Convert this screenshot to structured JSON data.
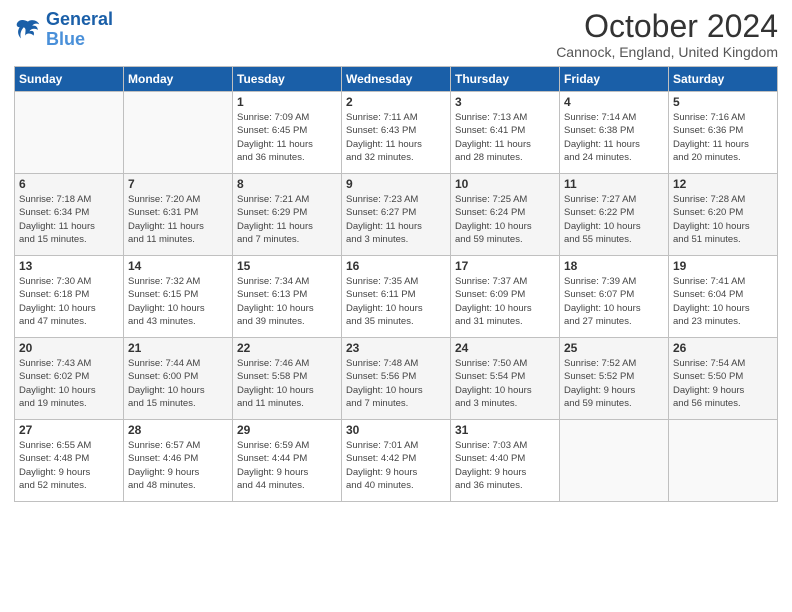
{
  "header": {
    "logo_line1": "General",
    "logo_line2": "Blue",
    "month": "October 2024",
    "location": "Cannock, England, United Kingdom"
  },
  "days_of_week": [
    "Sunday",
    "Monday",
    "Tuesday",
    "Wednesday",
    "Thursday",
    "Friday",
    "Saturday"
  ],
  "weeks": [
    [
      {
        "day": "",
        "info": ""
      },
      {
        "day": "",
        "info": ""
      },
      {
        "day": "1",
        "info": "Sunrise: 7:09 AM\nSunset: 6:45 PM\nDaylight: 11 hours\nand 36 minutes."
      },
      {
        "day": "2",
        "info": "Sunrise: 7:11 AM\nSunset: 6:43 PM\nDaylight: 11 hours\nand 32 minutes."
      },
      {
        "day": "3",
        "info": "Sunrise: 7:13 AM\nSunset: 6:41 PM\nDaylight: 11 hours\nand 28 minutes."
      },
      {
        "day": "4",
        "info": "Sunrise: 7:14 AM\nSunset: 6:38 PM\nDaylight: 11 hours\nand 24 minutes."
      },
      {
        "day": "5",
        "info": "Sunrise: 7:16 AM\nSunset: 6:36 PM\nDaylight: 11 hours\nand 20 minutes."
      }
    ],
    [
      {
        "day": "6",
        "info": "Sunrise: 7:18 AM\nSunset: 6:34 PM\nDaylight: 11 hours\nand 15 minutes."
      },
      {
        "day": "7",
        "info": "Sunrise: 7:20 AM\nSunset: 6:31 PM\nDaylight: 11 hours\nand 11 minutes."
      },
      {
        "day": "8",
        "info": "Sunrise: 7:21 AM\nSunset: 6:29 PM\nDaylight: 11 hours\nand 7 minutes."
      },
      {
        "day": "9",
        "info": "Sunrise: 7:23 AM\nSunset: 6:27 PM\nDaylight: 11 hours\nand 3 minutes."
      },
      {
        "day": "10",
        "info": "Sunrise: 7:25 AM\nSunset: 6:24 PM\nDaylight: 10 hours\nand 59 minutes."
      },
      {
        "day": "11",
        "info": "Sunrise: 7:27 AM\nSunset: 6:22 PM\nDaylight: 10 hours\nand 55 minutes."
      },
      {
        "day": "12",
        "info": "Sunrise: 7:28 AM\nSunset: 6:20 PM\nDaylight: 10 hours\nand 51 minutes."
      }
    ],
    [
      {
        "day": "13",
        "info": "Sunrise: 7:30 AM\nSunset: 6:18 PM\nDaylight: 10 hours\nand 47 minutes."
      },
      {
        "day": "14",
        "info": "Sunrise: 7:32 AM\nSunset: 6:15 PM\nDaylight: 10 hours\nand 43 minutes."
      },
      {
        "day": "15",
        "info": "Sunrise: 7:34 AM\nSunset: 6:13 PM\nDaylight: 10 hours\nand 39 minutes."
      },
      {
        "day": "16",
        "info": "Sunrise: 7:35 AM\nSunset: 6:11 PM\nDaylight: 10 hours\nand 35 minutes."
      },
      {
        "day": "17",
        "info": "Sunrise: 7:37 AM\nSunset: 6:09 PM\nDaylight: 10 hours\nand 31 minutes."
      },
      {
        "day": "18",
        "info": "Sunrise: 7:39 AM\nSunset: 6:07 PM\nDaylight: 10 hours\nand 27 minutes."
      },
      {
        "day": "19",
        "info": "Sunrise: 7:41 AM\nSunset: 6:04 PM\nDaylight: 10 hours\nand 23 minutes."
      }
    ],
    [
      {
        "day": "20",
        "info": "Sunrise: 7:43 AM\nSunset: 6:02 PM\nDaylight: 10 hours\nand 19 minutes."
      },
      {
        "day": "21",
        "info": "Sunrise: 7:44 AM\nSunset: 6:00 PM\nDaylight: 10 hours\nand 15 minutes."
      },
      {
        "day": "22",
        "info": "Sunrise: 7:46 AM\nSunset: 5:58 PM\nDaylight: 10 hours\nand 11 minutes."
      },
      {
        "day": "23",
        "info": "Sunrise: 7:48 AM\nSunset: 5:56 PM\nDaylight: 10 hours\nand 7 minutes."
      },
      {
        "day": "24",
        "info": "Sunrise: 7:50 AM\nSunset: 5:54 PM\nDaylight: 10 hours\nand 3 minutes."
      },
      {
        "day": "25",
        "info": "Sunrise: 7:52 AM\nSunset: 5:52 PM\nDaylight: 9 hours\nand 59 minutes."
      },
      {
        "day": "26",
        "info": "Sunrise: 7:54 AM\nSunset: 5:50 PM\nDaylight: 9 hours\nand 56 minutes."
      }
    ],
    [
      {
        "day": "27",
        "info": "Sunrise: 6:55 AM\nSunset: 4:48 PM\nDaylight: 9 hours\nand 52 minutes."
      },
      {
        "day": "28",
        "info": "Sunrise: 6:57 AM\nSunset: 4:46 PM\nDaylight: 9 hours\nand 48 minutes."
      },
      {
        "day": "29",
        "info": "Sunrise: 6:59 AM\nSunset: 4:44 PM\nDaylight: 9 hours\nand 44 minutes."
      },
      {
        "day": "30",
        "info": "Sunrise: 7:01 AM\nSunset: 4:42 PM\nDaylight: 9 hours\nand 40 minutes."
      },
      {
        "day": "31",
        "info": "Sunrise: 7:03 AM\nSunset: 4:40 PM\nDaylight: 9 hours\nand 36 minutes."
      },
      {
        "day": "",
        "info": ""
      },
      {
        "day": "",
        "info": ""
      }
    ]
  ]
}
